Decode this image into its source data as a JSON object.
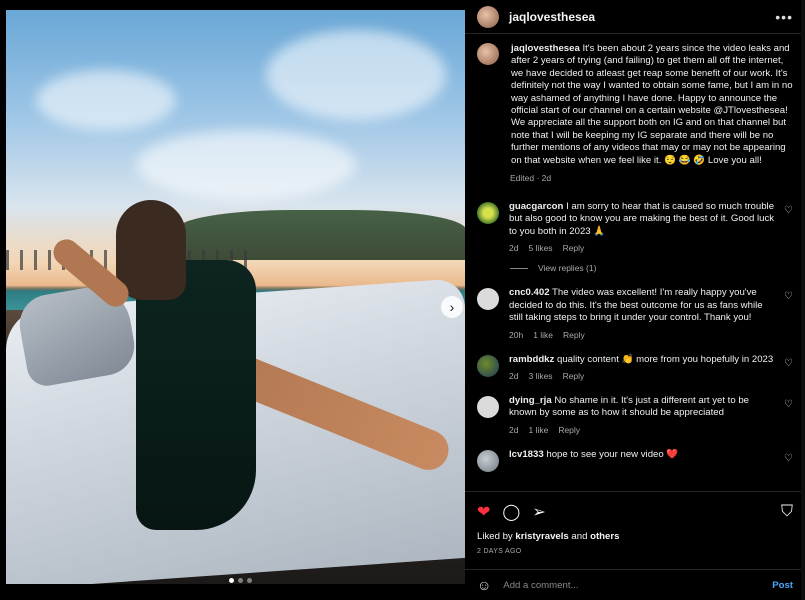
{
  "post": {
    "username": "jaqlovesthesea",
    "more_icon": "more-icon",
    "caption": "It's been about 2 years since the video leaks and after 2 years of trying (and failing) to get them all off the internet, we have decided to atleast get reap some benefit of our work. It's definitely not the way I wanted to obtain some fame, but I am in no way ashamed of anything I have done. Happy to announce the official start of our channel on a certain website @JTlovesthesea! We appreciate all the support both on IG and on that channel but note that I will be keeping my IG separate and there will be no further mentions of any videos that may or may not be appearing on that website when we feel like it. 😌 😂 🤣 Love you all!",
    "edited": "Edited · 2d"
  },
  "comments": [
    {
      "username": "guacgarcon",
      "text": "I am sorry to hear that is caused so much trouble but also good to know you are making the best of it. Good luck to you both in 2023 🙏",
      "time": "2d",
      "likes": "5 likes",
      "reply": "Reply",
      "view_replies": "View replies (1)"
    },
    {
      "username": "cnc0.402",
      "text": "The video was excellent! I'm really happy you've decided to do this. It's the best outcome for us as fans while still taking steps to bring it under your control. Thank you!",
      "time": "20h",
      "likes": "1 like",
      "reply": "Reply"
    },
    {
      "username": "rambddkz",
      "text": "quality content 👏 more from you hopefully in 2023",
      "time": "2d",
      "likes": "3 likes",
      "reply": "Reply"
    },
    {
      "username": "dying_rja",
      "text": "No shame in it. It's just a different art yet to be known by some as to how it should be appreciated",
      "time": "2d",
      "likes": "1 like",
      "reply": "Reply"
    },
    {
      "username": "lcv1833",
      "text": "hope to see your new video ❤️"
    }
  ],
  "footer": {
    "liked_by_prefix": "Liked by ",
    "liked_by_user": "kristyravels",
    "liked_by_mid": " and ",
    "liked_by_others": "others",
    "time_ago": "2 DAYS AGO",
    "comment_placeholder": "Add a comment...",
    "post_label": "Post"
  },
  "carousel": {
    "slides": 3,
    "active_slide": 1
  },
  "colors": {
    "background": "#000000",
    "accent": "#4aa8ff",
    "like_red": "#ff3040"
  }
}
